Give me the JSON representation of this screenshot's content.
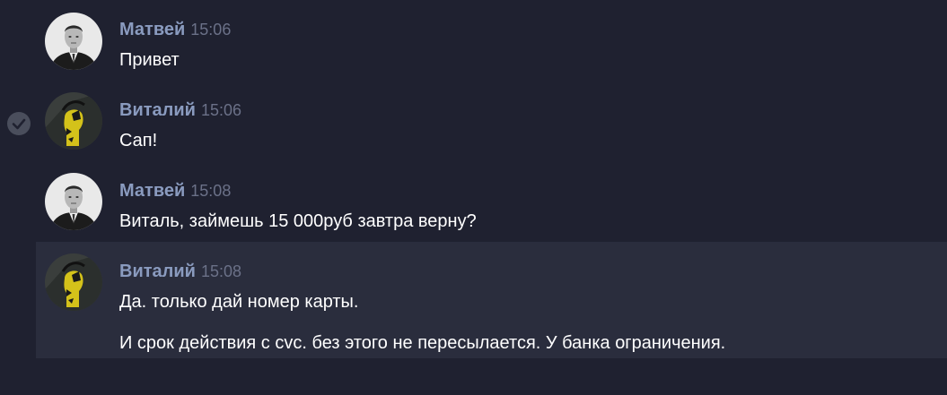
{
  "messages": [
    {
      "author": "Матвей",
      "time": "15:06",
      "avatar_icon": "man-portrait-avatar",
      "lines": [
        "Привет"
      ]
    },
    {
      "author": "Виталий",
      "time": "15:06",
      "avatar_icon": "yellow-figure-avatar",
      "lines": [
        "Сап!"
      ],
      "status_icon": "read-check-icon"
    },
    {
      "author": "Матвей",
      "time": "15:08",
      "avatar_icon": "man-portrait-avatar",
      "lines": [
        "Виталь, займешь 15 000руб завтра верну?"
      ]
    },
    {
      "author": "Виталий",
      "time": "15:08",
      "avatar_icon": "yellow-figure-avatar",
      "highlighted": true,
      "lines": [
        "Да. только дай номер карты.",
        "И срок действия с cvc. без этого не пересылается. У банка ограничения."
      ]
    }
  ],
  "colors": {
    "background": "#1f2130",
    "highlight": "#2a2d3d",
    "author": "#8a9bbf",
    "timestamp": "#6b7188",
    "text": "#ffffff"
  }
}
